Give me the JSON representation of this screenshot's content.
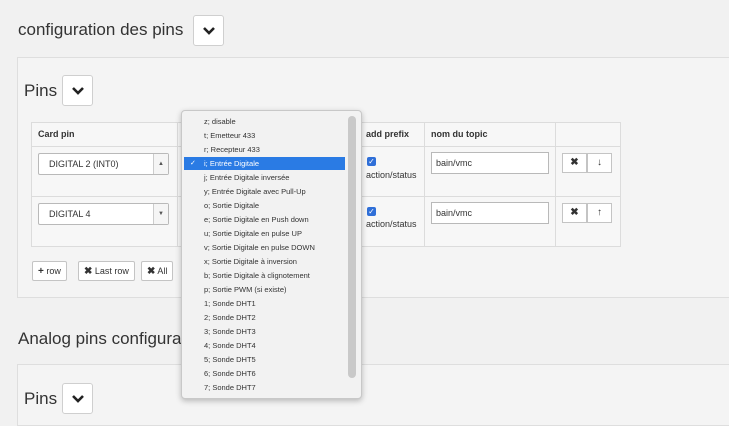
{
  "header": {
    "title": "configuration des pins"
  },
  "pins_panel": {
    "title": "Pins",
    "columns": [
      "Card pin",
      "add prefix",
      "nom du topic"
    ],
    "rows": [
      {
        "card_pin": "DIGITAL 2 (INT0)",
        "prefix_label": "action/status",
        "topic": "bain/vmc",
        "move_icon": "arrow-down-icon",
        "move_glyph": "↓"
      },
      {
        "card_pin": "DIGITAL 4",
        "prefix_label": "action/status",
        "topic": "bain/vmc",
        "move_icon": "arrow-up-icon",
        "move_glyph": "↑"
      }
    ],
    "remove_glyph": "✖",
    "buttons": {
      "add_row": "row",
      "last_row": "Last row",
      "all": "All"
    }
  },
  "analog": {
    "title": "Analog pins configurat",
    "pins_title": "Pins"
  },
  "dropdown": {
    "selected_index": 3,
    "options": [
      "z; disable",
      "t; Emetteur 433",
      "r; Recepteur 433",
      "i; Entrée Digitale",
      "j; Entrée Digitale inversée",
      "y; Entrée Digitale avec Pull-Up",
      "o; Sortie Digitale",
      "e; Sortie Digitale en Push down",
      "u; Sortie Digitale en pulse UP",
      "v; Sortie Digitale en pulse DOWN",
      "x; Sortie Digitale à inversion",
      "b; Sortie Digitale à clignotement",
      "p; Sortie PWM (si existe)",
      "1; Sonde DHT1",
      "2; Sonde DHT2",
      "3; Sonde DHT3",
      "4; Sonde DHT4",
      "5; Sonde DHT5",
      "6; Sonde DHT6",
      "7; Sonde DHT7"
    ]
  },
  "colors": {
    "accent": "#2a7be4",
    "checkbox": "#2f6fd8",
    "background": "#f1f1f1"
  }
}
